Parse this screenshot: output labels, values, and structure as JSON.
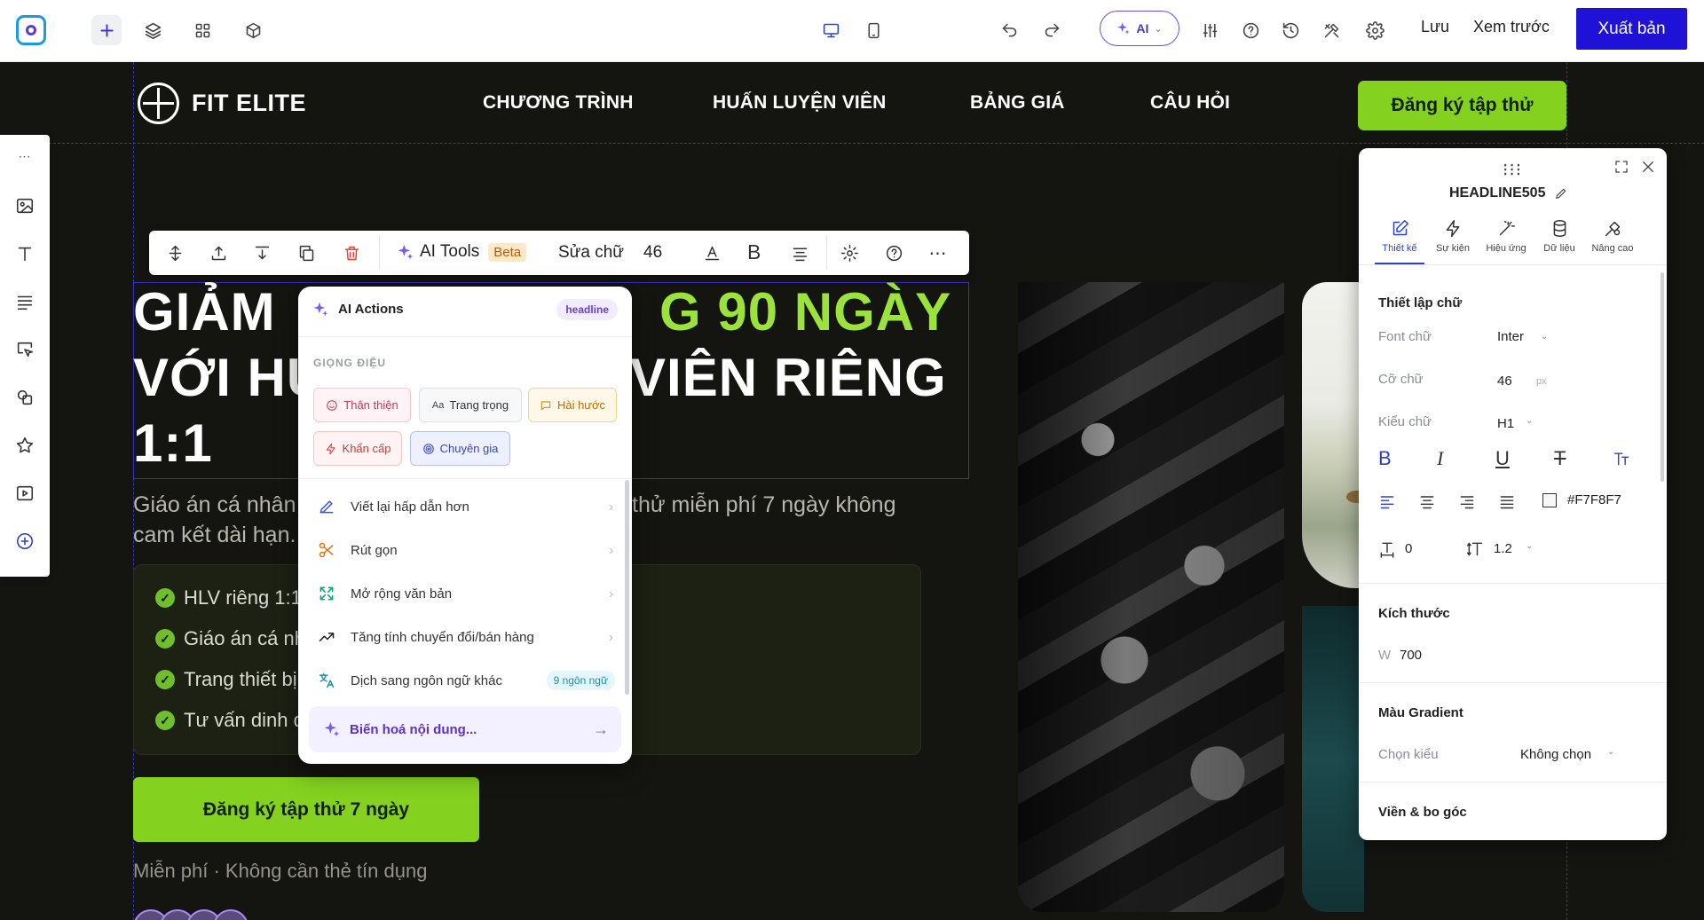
{
  "toolbar": {
    "ai_label": "AI",
    "save": "Lưu",
    "preview": "Xem trước",
    "publish": "Xuất bản"
  },
  "site": {
    "brand": "FIT ELITE",
    "nav": [
      "CHƯƠNG TRÌNH",
      "HUẤN LUYỆN VIÊN",
      "BẢNG GIÁ",
      "CÂU HỎI"
    ],
    "nav_cta": "Đăng ký tập thử",
    "headline_line1_a": "GIẢM ",
    "headline_line1_b": "G 90 NGÀY",
    "headline_line2_a": "VỚI HU",
    "headline_line2_b": "VIÊN RIÊNG",
    "headline_line3": "1:1",
    "sub_line1_a": "Giáo án cá nhân",
    "sub_line1_b": "thử miễn phí 7 ngày không",
    "sub_line2": "cam kết dài hạn.",
    "benefits": [
      "HLV riêng 1:1",
      "Giáo án cá nh",
      "Trang thiết bị",
      "Tư vấn dinh d"
    ],
    "main_cta": "Đăng ký tập thử 7 ngày",
    "fine_print": "Miễn phí · Không cần thẻ tín dụng"
  },
  "text_toolbar": {
    "ai_tools": "AI Tools",
    "beta": "Beta",
    "edit_text": "Sửa chữ",
    "font_size": "46",
    "bold_glyph": "B"
  },
  "ai_menu": {
    "title": "AI Actions",
    "badge": "headline",
    "section": "GIỌNG ĐIỆU",
    "tones": {
      "friendly": "Thân thiện",
      "formal_prefix": "Aa",
      "formal": "Trang trọng",
      "funny": "Hài hước",
      "urgent": "Khẩn cấp",
      "expert": "Chuyên gia"
    },
    "actions": {
      "rewrite": "Viết lại hấp dẫn hơn",
      "shorten": "Rút gọn",
      "expand": "Mở rộng văn bản",
      "convert": "Tăng tính chuyển đổi/bán hàng",
      "translate": "Dịch sang ngôn ngữ khác",
      "translate_badge": "9 ngôn ngữ"
    },
    "transform": "Biến hoá nội dung..."
  },
  "props": {
    "element_name": "HEADLINE505",
    "tabs": [
      "Thiết kế",
      "Sự kiện",
      "Hiệu ứng",
      "Dữ liệu",
      "Nâng cao"
    ],
    "text_section": "Thiết lập chữ",
    "font_label": "Font chữ",
    "font_value": "Inter",
    "size_label": "Cỡ chữ",
    "size_value": "46",
    "size_unit": "px",
    "style_label": "Kiểu chữ",
    "style_value": "H1",
    "color_value": "#F7F8F7",
    "letter_spacing": "0",
    "line_height": "1.2",
    "size_section": "Kích thước",
    "width_label": "W",
    "width_value": "700",
    "gradient_section": "Màu Gradient",
    "gradient_label": "Chọn kiểu",
    "gradient_value": "Không chọn",
    "border_section": "Viền & bo góc"
  },
  "colors": {
    "accent_green": "#84d11f",
    "publish_blue": "#1f12d6",
    "canvas_bg": "#141510",
    "ai_purple": "#7a5cf0"
  }
}
